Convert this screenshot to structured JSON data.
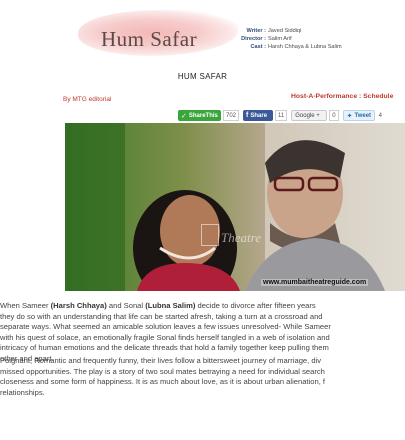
{
  "header": {
    "title": "Hum Safar",
    "credits": [
      {
        "label": "Writer :",
        "value": "Javed Siddiqi"
      },
      {
        "label": "Director :",
        "value": "Salim Arif"
      },
      {
        "label": "Cast :",
        "value": "Harsh Chhaya & Lubna Salim"
      }
    ]
  },
  "heading": "HUM SAFAR",
  "byline": "By MTG editorial",
  "tagline": "Host-A-Performance : Schedule",
  "share": {
    "sharethis_label": "ShareThis",
    "sharethis_count": "702",
    "facebook_label": "Share",
    "facebook_count": "11",
    "google_label": "Google +",
    "google_count": "0",
    "tweet_label": "Tweet",
    "tweet_count": "4"
  },
  "photo": {
    "watermark": "Theatre",
    "url": "www.mumbaitheatreguide.com"
  },
  "article": {
    "p1": [
      {
        "pre": "When Sameer ",
        "b1": "(Harsh Chhaya)",
        "mid": " and Sonal ",
        "b2": "(Lubna Salim)",
        "post": " decide to divorce after fifteen years"
      },
      "they do so with an understanding that life can be started afresh, taking a turn at a crossroad and",
      "separate ways. What seemed an amicable solution leaves a few issues unresolved- While Sameer",
      "with his quest of solace, an emotionally fragile Sonal finds herself tangled in a web of isolation and",
      "intricacy of human emotions and the delicate threads that hold a family together keep pulling them",
      "other and apart."
    ],
    "p2": [
      "Poignant, Romantic and frequently funny, their lives follow a bittersweet journey of marriage, div",
      "missed opportunities. The play is a story of two soul mates betraying a need for individual search",
      "closeness and some form of happiness. It is as much about love, as it is about urban alienation, f",
      "relationships."
    ]
  },
  "colors": {
    "accent_red": "#c0392b",
    "sharethis_green": "#3aa53a",
    "facebook_blue": "#3b5998",
    "credits_blue": "#344a7a"
  }
}
